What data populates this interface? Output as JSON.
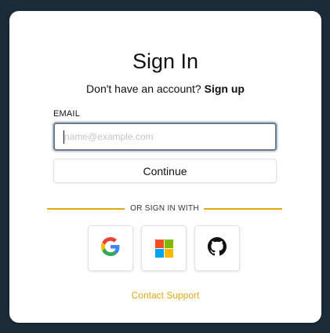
{
  "header": {
    "title": "Sign In"
  },
  "signup": {
    "prompt": "Don't have an account?",
    "link_label": "Sign up"
  },
  "email": {
    "label": "EMAIL",
    "placeholder": "name@example.com",
    "value": ""
  },
  "continue_label": "Continue",
  "divider_text": "OR SIGN IN WITH",
  "social": [
    {
      "name": "Google",
      "icon": "google-icon"
    },
    {
      "name": "Microsoft",
      "icon": "microsoft-icon"
    },
    {
      "name": "GitHub",
      "icon": "github-icon"
    }
  ],
  "support_label": "Contact Support",
  "colors": {
    "background": "#1b2b38",
    "accent": "#e0a812",
    "google_blue": "#4285F4",
    "google_red": "#EA4335",
    "google_yellow": "#FBBC05",
    "google_green": "#34A853",
    "ms_red": "#F25022",
    "ms_green": "#7FBA00",
    "ms_blue": "#00A4EF",
    "ms_yellow": "#FFB900"
  }
}
